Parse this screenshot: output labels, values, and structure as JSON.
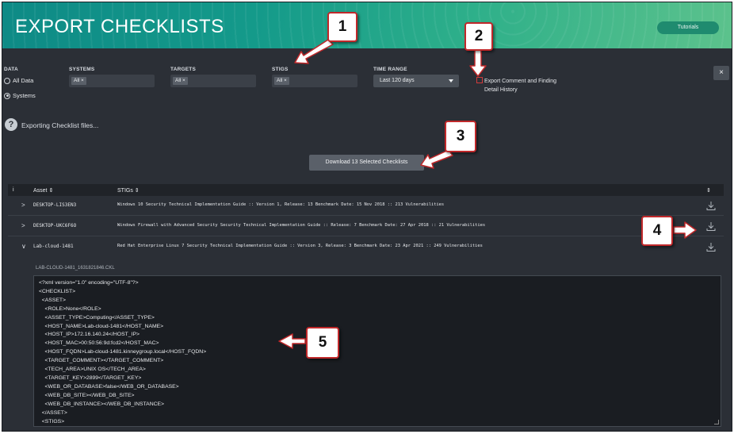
{
  "header": {
    "title": "EXPORT CHECKLISTS",
    "tutorials_label": "Tutorials"
  },
  "filters": {
    "data_label": "DATA",
    "data_options": [
      {
        "label": "All Data",
        "selected": false
      },
      {
        "label": "Systems",
        "selected": true
      }
    ],
    "systems_label": "SYSTEMS",
    "systems_chip": "All ×",
    "targets_label": "TARGETS",
    "targets_chip": "All ×",
    "stigs_label": "STIGS",
    "stigs_chip": "All ×",
    "time_label": "TIME RANGE",
    "time_value": "Last 120 days",
    "export_comment_label": "Export Comment and Finding Detail History",
    "close_label": "×"
  },
  "status": {
    "exporting_text": "Exporting Checklist files...",
    "help_icon": "?"
  },
  "download_button": "Download 13 Selected Checklists",
  "table": {
    "headers": {
      "info": "i",
      "asset": "Asset ⇕",
      "stigs": "STIGs ⇕",
      "sort": "⇕"
    },
    "rows": [
      {
        "chevron": ">",
        "asset": "DESKTOP-LIS3EN3",
        "stig": "Windows 10 Security Technical Implementation Guide :: Version 1, Release: 13 Benchmark Date: 15 Nov 2018 :: 213 Vulnerabilities"
      },
      {
        "chevron": ">",
        "asset": "DESKTOP-UKC6F6O",
        "stig": "Windows Firewall with Advanced Security Security Technical Implementation Guide :: Release: 7 Benchmark Date: 27 Apr 2018 :: 21 Vulnerabilities"
      },
      {
        "chevron": "∨",
        "asset": "Lab-cloud-1481",
        "stig": "Red Hat Enterprise Linux 7 Security Technical Implementation Guide :: Version 3, Release: 3 Benchmark Date: 23 Apr 2021 :: 249 Vulnerabilities"
      }
    ]
  },
  "detail": {
    "filename": "LAB-CLOUD-1481_1631821846.CKL",
    "xml_lines": [
      "<?xml version=\"1.0\" encoding=\"UTF-8\"?>",
      "<CHECKLIST>",
      "  <ASSET>",
      "    <ROLE>None</ROLE>",
      "    <ASSET_TYPE>Computing</ASSET_TYPE>",
      "    <HOST_NAME>Lab-cloud-1481</HOST_NAME>",
      "    <HOST_IP>172.16.140.24</HOST_IP>",
      "    <HOST_MAC>00:50:56:9d:fcd2</HOST_MAC>",
      "    <HOST_FQDN>Lab-cloud-1481.kinneygroup.local</HOST_FQDN>",
      "    <TARGET_COMMENT></TARGET_COMMENT>",
      "    <TECH_AREA>UNIX OS</TECH_AREA>",
      "    <TARGET_KEY>2899</TARGET_KEY>",
      "    <WEB_OR_DATABASE>false</WEB_OR_DATABASE>",
      "    <WEB_DB_SITE></WEB_DB_SITE>",
      "    <WEB_DB_INSTANCE></WEB_DB_INSTANCE>",
      "  </ASSET>",
      "  <STIGS>"
    ]
  },
  "callouts": [
    "1",
    "2",
    "3",
    "4",
    "5"
  ],
  "colors": {
    "accent_red": "#c0282a",
    "header_teal": "#149a8a",
    "panel_bg": "#2b2f36"
  },
  "icons": {
    "download": "download-icon",
    "help": "question-circle-icon"
  }
}
